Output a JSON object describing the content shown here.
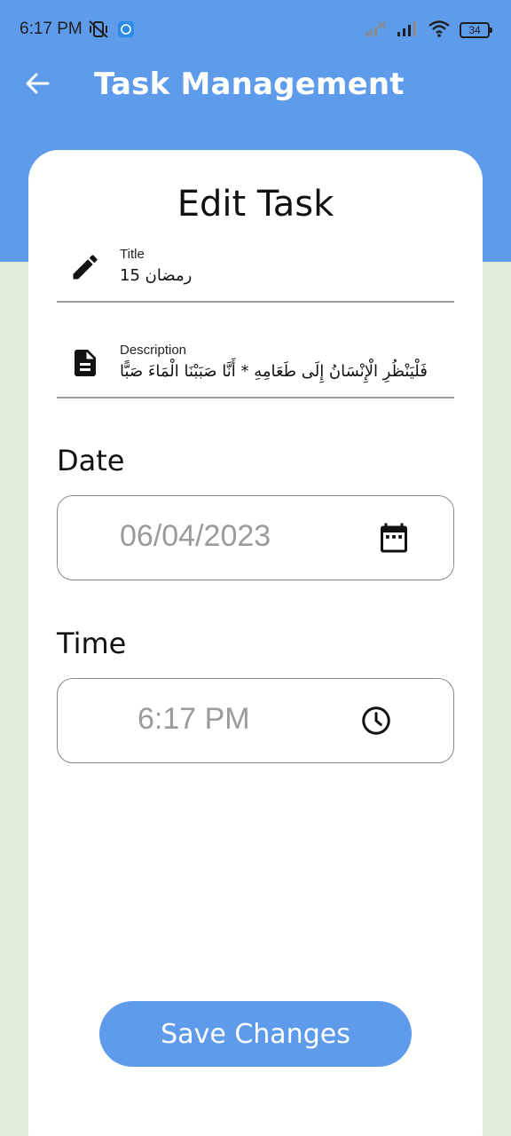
{
  "status_bar": {
    "time": "6:17 PM",
    "battery": "34",
    "icons": [
      "mute-vibrate-icon",
      "vpn-app-icon",
      "signal-x-icon",
      "signal-icon",
      "wifi-icon",
      "battery-icon"
    ]
  },
  "app_bar": {
    "title": "Task Management",
    "back_icon": "arrow-left-icon"
  },
  "card": {
    "heading": "Edit Task",
    "title_field": {
      "label": "Title",
      "value": "رمضان 15",
      "icon": "pencil-icon"
    },
    "description_field": {
      "label": "Description",
      "value": "فَلْيَنْظُرِ الْإِنْسَانُ إِلَى طَعَامِهِ * أَنَّا صَبَبْنَا الْمَاءَ صَبًّا",
      "icon": "document-icon"
    },
    "date": {
      "label": "Date",
      "value": "06/04/2023",
      "icon": "calendar-icon"
    },
    "time": {
      "label": "Time",
      "value": "6:17 PM",
      "icon": "clock-icon"
    },
    "save_label": "Save Changes"
  },
  "colors": {
    "primary": "#5e9bea",
    "background": "#e1ecdc",
    "card": "#ffffff"
  }
}
